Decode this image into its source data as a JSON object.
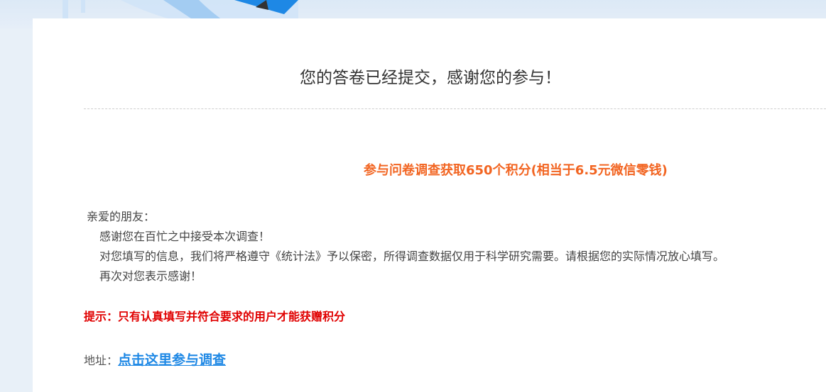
{
  "header": {
    "title": "您的答卷已经提交，感谢您的参与！"
  },
  "promo": {
    "text": "参与问卷调查获取650个积分(相当于6.5元微信零钱)",
    "color": "#f26522"
  },
  "message": {
    "greeting": "亲爱的朋友：",
    "lines": [
      "感谢您在百忙之中接受本次调查！",
      "对您填写的信息，我们将严格遵守《统计法》予以保密，所得调查数据仅用于科学研究需要。请根据您的实际情况放心填写。",
      "再次对您表示感谢！"
    ]
  },
  "tip": {
    "text": "提示：只有认真填写并符合要求的用户才能获赠积分",
    "color": "#e00000"
  },
  "address": {
    "label": "地址：",
    "link_text": "点击这里参与调查",
    "link_color": "#1e88e5"
  }
}
